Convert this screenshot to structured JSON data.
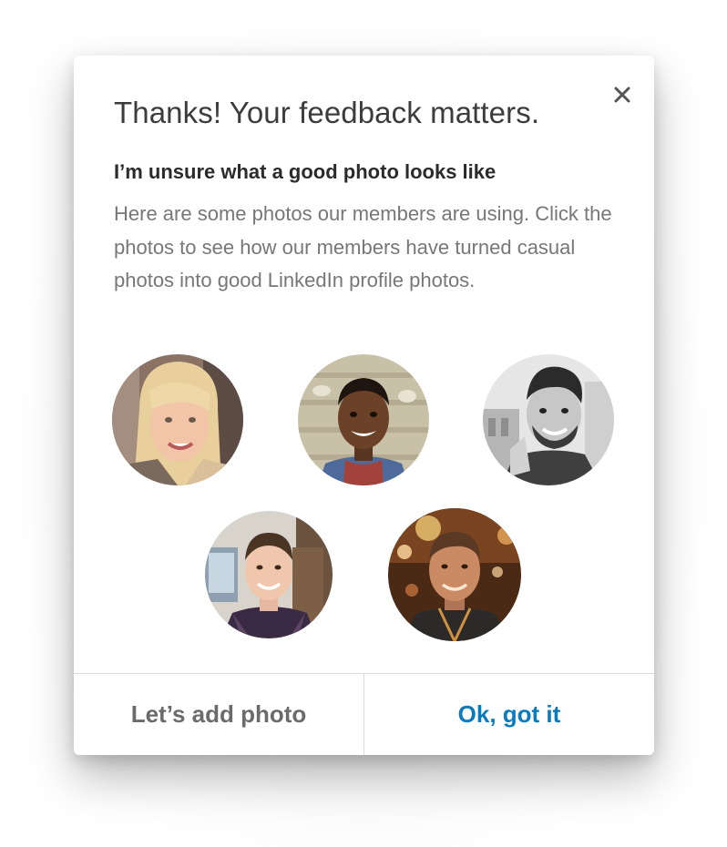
{
  "modal": {
    "title": "Thanks! Your feedback matters.",
    "subtitle": "I’m unsure what a good photo looks like",
    "description": "Here are some photos our members are using. Click the photos to see how our members have turned casual photos into good LinkedIn profile photos.",
    "close_icon": "close-icon"
  },
  "photos": [
    {
      "kind": "member-photo",
      "style": "color"
    },
    {
      "kind": "member-photo",
      "style": "color"
    },
    {
      "kind": "member-photo",
      "style": "grayscale"
    },
    {
      "kind": "member-photo",
      "style": "color"
    },
    {
      "kind": "member-photo",
      "style": "color"
    }
  ],
  "footer": {
    "secondary_label": "Let’s add photo",
    "primary_label": "Ok, got it"
  },
  "colors": {
    "primary": "#0a7bbd",
    "secondary_text": "#6b6b6b",
    "title_text": "#3c3c3c",
    "body_text": "#777777"
  }
}
